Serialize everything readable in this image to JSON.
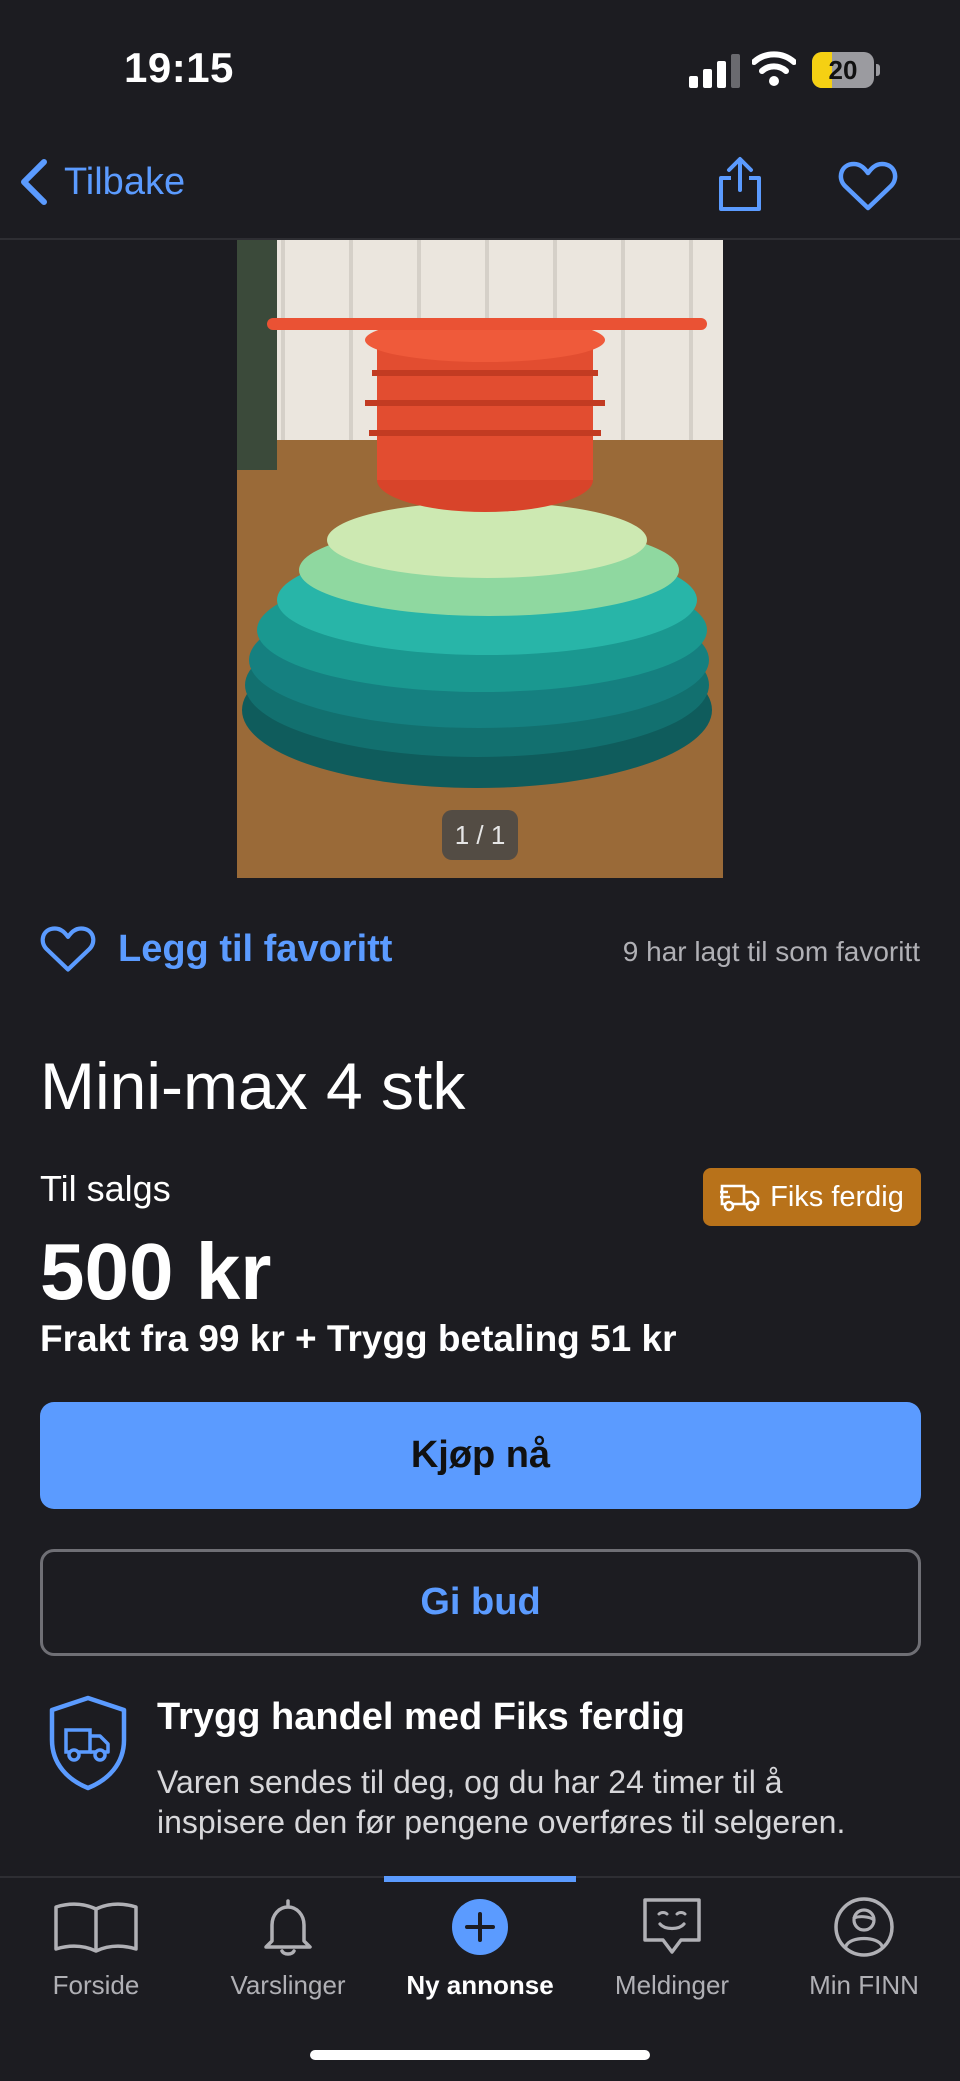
{
  "status_bar": {
    "time": "19:15",
    "battery": "20"
  },
  "nav": {
    "back_label": "Tilbake"
  },
  "image": {
    "counter": "1 / 1"
  },
  "favorite": {
    "label": "Legg til favoritt",
    "count_text": "9 har lagt til som favoritt"
  },
  "listing": {
    "title": "Mini-max 4 stk",
    "sale_type": "Til salgs",
    "badge": "Fiks ferdig",
    "price": "500 kr",
    "shipping": "Frakt fra 99 kr + Trygg betaling 51 kr"
  },
  "actions": {
    "buy_label": "Kjøp nå",
    "bid_label": "Gi bud"
  },
  "safe_trade": {
    "title": "Trygg handel med Fiks ferdig",
    "description": "Varen sendes til deg, og du har 24 timer til å inspisere den før pengene overføres til selgeren."
  },
  "tabbar": {
    "items": [
      {
        "label": "Forside",
        "icon": "book-icon"
      },
      {
        "label": "Varslinger",
        "icon": "bell-icon"
      },
      {
        "label": "Ny annonse",
        "icon": "plus-circle-icon"
      },
      {
        "label": "Meldinger",
        "icon": "chat-icon"
      },
      {
        "label": "Min FINN",
        "icon": "profile-icon"
      }
    ],
    "active_index": 2
  },
  "colors": {
    "accent": "#5b9bff",
    "badge": "#b8721a",
    "background": "#1c1c21"
  }
}
